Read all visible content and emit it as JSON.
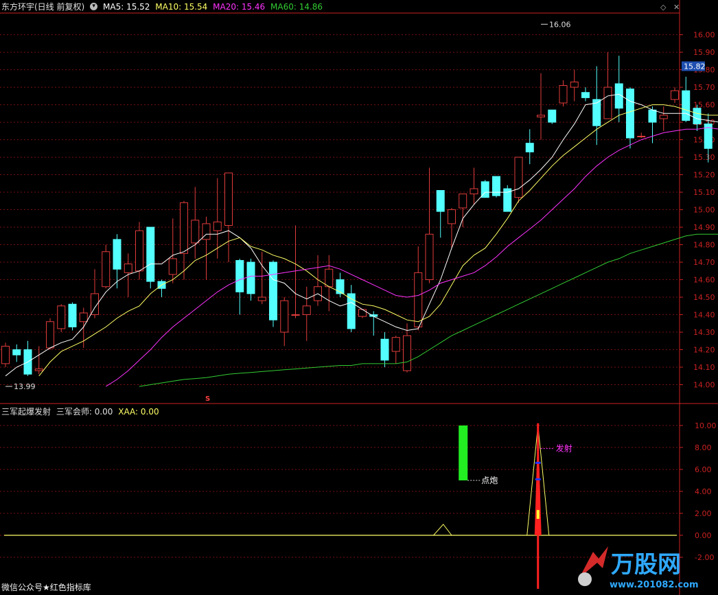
{
  "header": {
    "stock": "东方环宇(日线 前复权)",
    "ma5": "MA5: 15.52",
    "ma10": "MA10: 15.54",
    "ma20": "MA20: 15.46",
    "ma60": "MA60: 14.86"
  },
  "indicator_header": {
    "name": "三军起爆发射",
    "value1": "三军会师: 0.00",
    "value2": "XAA: 0.00"
  },
  "footer": "微信公众号★红色指标库",
  "watermark": {
    "logo_text": "万股网",
    "url": "www.201082.com"
  },
  "colors": {
    "up": "#e23c3c",
    "down": "#54ffff",
    "ma5": "#ffffff",
    "ma10": "#ffff66",
    "ma20": "#ff33ff",
    "ma60": "#33cc33",
    "grid": "#7a1010",
    "axis": "#cc2222"
  },
  "chart_data": [
    {
      "type": "candlestick",
      "title": "东方环宇(日线 前复权)",
      "ylim": [
        13.9,
        16.12
      ],
      "price_ticks": [
        "16.00",
        "15.90",
        "15.80",
        "15.70",
        "15.60",
        "15.50",
        "15.40",
        "15.30",
        "15.20",
        "15.10",
        "15.00",
        "14.90",
        "14.80",
        "14.70",
        "14.60",
        "14.50",
        "14.40",
        "14.30",
        "14.20",
        "14.10",
        "14.00"
      ],
      "current_price": "15.82",
      "high_label": "16.06",
      "low_label": "13.99",
      "marker_label": "S",
      "candles": [
        [
          14.12,
          14.22,
          14.24,
          14.1
        ],
        [
          14.2,
          14.17,
          14.23,
          14.13
        ],
        [
          14.2,
          14.06,
          14.25,
          14.05
        ],
        [
          14.08,
          14.09,
          14.22,
          14.06
        ],
        [
          14.21,
          14.36,
          14.38,
          14.2
        ],
        [
          14.32,
          14.45,
          14.46,
          14.3
        ],
        [
          14.46,
          14.33,
          14.47,
          14.31
        ],
        [
          14.36,
          14.41,
          14.44,
          14.21
        ],
        [
          14.4,
          14.52,
          14.66,
          14.38
        ],
        [
          14.56,
          14.76,
          14.8,
          14.55
        ],
        [
          14.83,
          14.66,
          14.86,
          14.55
        ],
        [
          14.64,
          14.69,
          14.75,
          14.5
        ],
        [
          14.65,
          14.88,
          14.93,
          14.6
        ],
        [
          14.9,
          14.59,
          14.9,
          14.55
        ],
        [
          14.59,
          14.55,
          14.6,
          14.5
        ],
        [
          14.63,
          14.72,
          14.95,
          14.58
        ],
        [
          14.75,
          15.04,
          15.05,
          14.6
        ],
        [
          14.81,
          14.94,
          15.13,
          14.72
        ],
        [
          14.83,
          14.92,
          14.96,
          14.6
        ],
        [
          14.88,
          14.93,
          15.18,
          14.72
        ],
        [
          14.91,
          15.21,
          15.21,
          14.7
        ],
        [
          14.71,
          14.53,
          14.72,
          14.4
        ],
        [
          14.7,
          14.52,
          14.72,
          14.48
        ],
        [
          14.48,
          14.5,
          14.76,
          14.46
        ],
        [
          14.7,
          14.37,
          14.71,
          14.33
        ],
        [
          14.3,
          14.48,
          14.5,
          14.22
        ],
        [
          14.4,
          14.4,
          14.91,
          14.38
        ],
        [
          14.4,
          14.45,
          14.56,
          14.25
        ],
        [
          14.48,
          14.56,
          14.74,
          14.45
        ],
        [
          14.56,
          14.66,
          14.74,
          14.42
        ],
        [
          14.6,
          14.52,
          14.64,
          14.5
        ],
        [
          14.52,
          14.32,
          14.57,
          14.3
        ],
        [
          14.39,
          14.43,
          14.43,
          14.38
        ],
        [
          14.4,
          14.39,
          14.42,
          14.28
        ],
        [
          14.26,
          14.14,
          14.3,
          14.1
        ],
        [
          14.19,
          14.27,
          14.28,
          14.12
        ],
        [
          14.08,
          14.28,
          14.35,
          14.07
        ],
        [
          14.33,
          14.64,
          14.79,
          14.31
        ],
        [
          14.6,
          14.86,
          15.24,
          14.58
        ],
        [
          15.11,
          14.99,
          15.11,
          14.84
        ],
        [
          14.92,
          15.0,
          15.01,
          14.78
        ],
        [
          15.01,
          15.09,
          15.07,
          14.9
        ],
        [
          15.09,
          15.12,
          15.24,
          15.03
        ],
        [
          15.16,
          15.07,
          15.17,
          15.07
        ],
        [
          15.19,
          15.08,
          15.19,
          15.07
        ],
        [
          15.12,
          14.99,
          15.14,
          14.99
        ],
        [
          15.07,
          15.3,
          15.25,
          15.04
        ],
        [
          15.38,
          15.33,
          15.46,
          15.26
        ],
        [
          15.53,
          15.54,
          15.78,
          15.4
        ],
        [
          15.57,
          15.5,
          15.57,
          15.49
        ],
        [
          15.61,
          15.71,
          15.74,
          15.59
        ],
        [
          15.7,
          15.73,
          15.8,
          15.62
        ],
        [
          15.67,
          15.64,
          15.7,
          15.62
        ],
        [
          15.63,
          15.48,
          15.82,
          15.37
        ],
        [
          15.52,
          15.7,
          15.9,
          15.58
        ],
        [
          15.72,
          15.58,
          15.88,
          15.5
        ],
        [
          15.69,
          15.41,
          15.7,
          15.35
        ],
        [
          15.42,
          15.42,
          15.44,
          15.41
        ],
        [
          15.57,
          15.5,
          15.59,
          15.38
        ],
        [
          15.52,
          15.54,
          15.59,
          15.45
        ],
        [
          15.63,
          15.68,
          15.7,
          15.61
        ],
        [
          15.68,
          15.51,
          15.76,
          15.5
        ],
        [
          15.58,
          15.49,
          15.6,
          15.45
        ],
        [
          15.49,
          15.35,
          15.55,
          15.27
        ]
      ],
      "ma_lines": [
        {
          "name": "MA5",
          "values": [
            14.05,
            14.1,
            14.13,
            14.17,
            14.21,
            14.24,
            14.26,
            14.33,
            14.44,
            14.53,
            14.59,
            14.63,
            14.65,
            14.69,
            14.69,
            14.74,
            14.76,
            14.8,
            14.86,
            14.86,
            14.88,
            14.84,
            14.78,
            14.68,
            14.6,
            14.58,
            14.52,
            14.49,
            14.52,
            14.48,
            14.45,
            14.47,
            14.43,
            14.39,
            14.36,
            14.33,
            14.31,
            14.32,
            14.46,
            14.6,
            14.78,
            14.95,
            15.03,
            15.1,
            15.1,
            15.1,
            15.12,
            15.17,
            15.23,
            15.3,
            15.4,
            15.49,
            15.6,
            15.61,
            15.65,
            15.66,
            15.62,
            15.6,
            15.57,
            15.55,
            15.55,
            15.55,
            15.52,
            15.51,
            15.5
          ]
        },
        {
          "name": "MA10",
          "values": [
            null,
            null,
            null,
            14.05,
            14.13,
            14.19,
            14.22,
            14.25,
            14.29,
            14.33,
            14.38,
            14.42,
            14.45,
            14.52,
            14.57,
            14.6,
            14.65,
            14.71,
            14.74,
            14.78,
            14.82,
            14.84,
            14.79,
            14.77,
            14.74,
            14.72,
            14.69,
            14.65,
            14.6,
            14.56,
            14.53,
            14.49,
            14.46,
            14.45,
            14.43,
            14.4,
            14.37,
            14.36,
            14.39,
            14.46,
            14.57,
            14.68,
            14.74,
            14.78,
            14.86,
            14.95,
            15.05,
            15.11,
            15.18,
            15.25,
            15.31,
            15.36,
            15.41,
            15.46,
            15.5,
            15.54,
            15.56,
            15.58,
            15.6,
            15.6,
            15.59,
            15.57,
            15.55,
            15.54,
            15.54
          ]
        },
        {
          "name": "MA20",
          "values": [
            null,
            null,
            null,
            null,
            null,
            null,
            null,
            null,
            null,
            13.99,
            14.03,
            14.08,
            14.14,
            14.2,
            14.27,
            14.33,
            14.38,
            14.43,
            14.48,
            14.53,
            14.57,
            14.6,
            14.62,
            14.62,
            14.63,
            14.64,
            14.65,
            14.66,
            14.67,
            14.68,
            14.66,
            14.63,
            14.6,
            14.57,
            14.54,
            14.51,
            14.5,
            14.51,
            14.54,
            14.58,
            14.6,
            14.62,
            14.64,
            14.68,
            14.73,
            14.79,
            14.84,
            14.89,
            14.94,
            15.0,
            15.06,
            15.12,
            15.19,
            15.25,
            15.3,
            15.34,
            15.37,
            15.4,
            15.42,
            15.44,
            15.45,
            15.46,
            15.46,
            15.47,
            15.46
          ]
        },
        {
          "name": "MA60",
          "values": [
            null,
            null,
            null,
            null,
            null,
            null,
            null,
            null,
            null,
            null,
            null,
            null,
            13.99,
            14.0,
            14.01,
            14.02,
            14.03,
            14.035,
            14.04,
            14.05,
            14.06,
            14.065,
            14.07,
            14.075,
            14.08,
            14.085,
            14.09,
            14.095,
            14.1,
            14.105,
            14.11,
            14.11,
            14.12,
            14.12,
            14.12,
            14.12,
            14.13,
            14.16,
            14.2,
            14.24,
            14.28,
            14.31,
            14.34,
            14.37,
            14.4,
            14.43,
            14.46,
            14.49,
            14.52,
            14.55,
            14.58,
            14.61,
            14.64,
            14.67,
            14.7,
            14.72,
            14.75,
            14.77,
            14.79,
            14.81,
            14.83,
            14.85,
            14.86,
            14.86,
            14.86
          ]
        }
      ]
    },
    {
      "type": "bar",
      "title": "三军起爆发射",
      "ylim": [
        -5.0,
        11.0
      ],
      "y_ticks": [
        "10.00",
        "8.00",
        "6.00",
        "4.00",
        "2.00",
        "0.00",
        "-2.00"
      ],
      "labels": [
        "点炮",
        "发射"
      ],
      "green_bar": {
        "index": 41,
        "from": 5.0,
        "to": 10.0
      },
      "launch": {
        "index": 47,
        "peak": 10.0,
        "low": -5.0
      }
    }
  ]
}
